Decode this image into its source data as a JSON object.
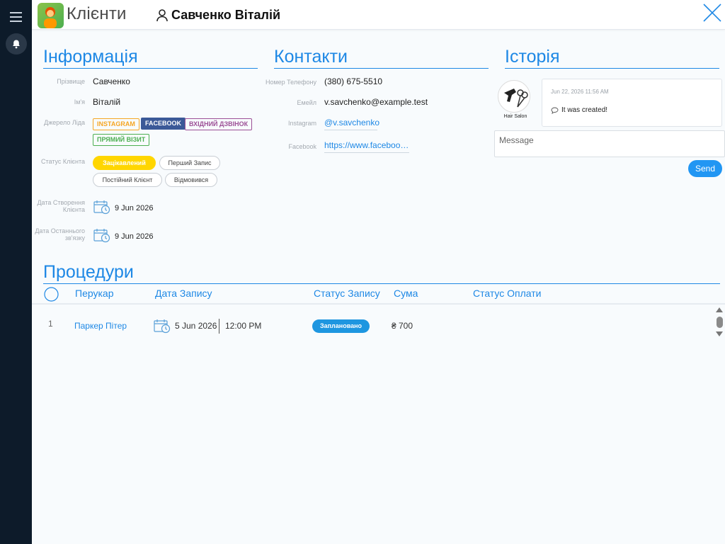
{
  "app": {
    "title": "Клієнти"
  },
  "client": {
    "full_name": "Савченко Віталій"
  },
  "colors": {
    "accent": "#1e88e5",
    "active_status": "#ffd600",
    "sidebar": "#0d1b2a",
    "scheduled": "#1e96e0"
  },
  "info": {
    "heading": "Інформація",
    "surname_label": "Прізвище",
    "surname": "Савченко",
    "name_label": "Ім'я",
    "name": "Віталій",
    "source_label": "Джерело Ліда",
    "sources": [
      {
        "label": "INSTAGRAM",
        "color": "#f5a623"
      },
      {
        "label": "FACEBOOK",
        "color": "#3b5998",
        "active": true
      },
      {
        "label": "ВХІДНИЙ ДЗВІНОК",
        "color": "#9c4f96"
      },
      {
        "label": "ПРЯМИЙ ВІЗИТ",
        "color": "#4caf50"
      }
    ],
    "status_label": "Статус Клієнта",
    "statuses": [
      {
        "label": "Зацікавлений",
        "active": true
      },
      {
        "label": "Перший Запис"
      },
      {
        "label": "Постійний Клієнт"
      },
      {
        "label": "Відмовився"
      }
    ],
    "created_label_1": "Дата Створення",
    "created_label_2": "Клієнта",
    "created_date": "9 Jun 2026",
    "last_contact_label_1": "Дата Останнього",
    "last_contact_label_2": "зв'язку",
    "last_contact_date": "9 Jun 2026"
  },
  "contacts": {
    "heading": "Контакти",
    "phone_label": "Номер Телефону",
    "phone": "(380) 675-5510",
    "email_label": "Емейл",
    "email": "v.savchenko@example.test",
    "instagram_label": "Instagram",
    "instagram": "@v.savchenko",
    "facebook_label": "Facebook",
    "facebook": "https://www.faceboo…"
  },
  "history": {
    "heading": "Історія",
    "avatar_caption": "Hair Salon",
    "entry_time": "Jun 22, 2026 11:56 AM",
    "entry_text": "It was created!",
    "message_placeholder": "Message",
    "send_label": "Send"
  },
  "procedures": {
    "heading": "Процедури",
    "columns": [
      "Перукар",
      "Дата Запису",
      "Статус Запису",
      "Сума",
      "Статус Оплати"
    ],
    "rows": [
      {
        "num": "1",
        "stylist": "Паркер Пітер",
        "date": "5 Jun 2026",
        "time": "12:00 PM",
        "status": "Заплановано",
        "amount": "₴ 700",
        "payment": ""
      }
    ]
  }
}
